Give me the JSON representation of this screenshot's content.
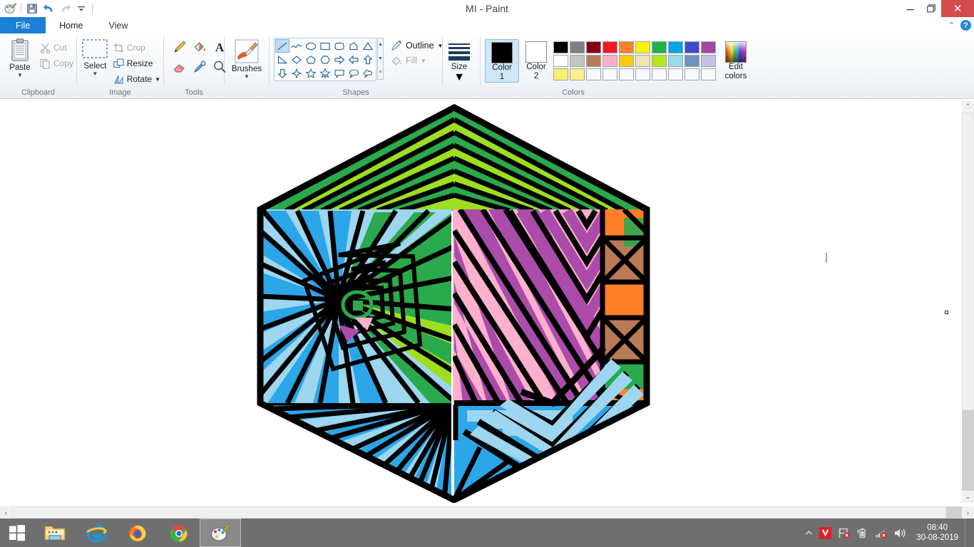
{
  "window": {
    "title": "MI - Paint",
    "minimize_label": "–",
    "maximize_label": "❐",
    "close_label": "✕"
  },
  "quick_access": {
    "items": [
      {
        "name": "paint-app-icon",
        "label": "Paint"
      },
      {
        "name": "save-icon",
        "label": "Save"
      },
      {
        "name": "undo-icon",
        "label": "Undo"
      },
      {
        "name": "redo-icon",
        "label": "Redo"
      },
      {
        "name": "customize-qat-icon",
        "label": "Customize Quick Access Toolbar"
      }
    ]
  },
  "tabs": [
    {
      "id": "file",
      "label": "File",
      "active": false
    },
    {
      "id": "home",
      "label": "Home",
      "active": true
    },
    {
      "id": "view",
      "label": "View",
      "active": false
    }
  ],
  "ribbon_helpers": {
    "collapse_label": "⌃",
    "help_label": "?"
  },
  "ribbon": {
    "groups": [
      {
        "id": "clipboard",
        "label": "Clipboard",
        "big_button": {
          "label": "Paste",
          "caret": "▼"
        },
        "small_buttons": [
          {
            "label": "Cut",
            "icon": "scissors-icon",
            "disabled": true
          },
          {
            "label": "Copy",
            "icon": "copy-icon",
            "disabled": true
          }
        ]
      },
      {
        "id": "image",
        "label": "Image",
        "big_button": {
          "label": "Select",
          "caret": "▼"
        },
        "small_buttons": [
          {
            "label": "Crop",
            "icon": "crop-icon",
            "disabled": true
          },
          {
            "label": "Resize",
            "icon": "resize-icon",
            "disabled": false
          },
          {
            "label": "Rotate",
            "icon": "rotate-icon",
            "disabled": false,
            "caret": "▼"
          }
        ]
      },
      {
        "id": "tools",
        "label": "Tools",
        "tools": [
          {
            "name": "pencil-tool-icon",
            "label": "Pencil"
          },
          {
            "name": "fill-with-color-tool-icon",
            "label": "Fill with color"
          },
          {
            "name": "text-tool-icon",
            "label": "Text"
          },
          {
            "name": "eraser-tool-icon",
            "label": "Eraser"
          },
          {
            "name": "color-picker-tool-icon",
            "label": "Color picker"
          },
          {
            "name": "magnifier-tool-icon",
            "label": "Magnifier"
          }
        ]
      },
      {
        "id": "brushes",
        "label": "",
        "big_button": {
          "label": "Brushes",
          "caret": "▼"
        }
      },
      {
        "id": "shapes",
        "label": "Shapes",
        "shape_items": [
          "line-shape",
          "curve-shape",
          "oval-shape",
          "rectangle-shape",
          "rounded-rectangle-shape",
          "polygon-shape",
          "triangle-shape",
          "right-triangle-shape",
          "diamond-shape",
          "pentagon-shape",
          "hexagon-shape",
          "right-arrow-shape",
          "left-arrow-shape",
          "up-arrow-shape",
          "down-arrow-shape",
          "four-point-star-shape",
          "five-point-star-shape",
          "six-point-star-shape",
          "rounded-callout-shape",
          "oval-callout-shape",
          "cloud-callout-shape"
        ],
        "selected_shape": "line-shape",
        "outline": {
          "label": "Outline",
          "caret": "▼"
        },
        "fill": {
          "label": "Fill",
          "caret": "▼",
          "disabled": true
        },
        "scroll": {
          "up": "▲",
          "down": "▼",
          "more": "≡"
        }
      },
      {
        "id": "size",
        "label": "",
        "big_button": {
          "label": "Size",
          "caret": "▼"
        }
      },
      {
        "id": "colors",
        "label": "Colors",
        "color1": {
          "label_line1": "Color",
          "label_line2": "1",
          "value": "#000000",
          "active": true
        },
        "color2": {
          "label_line1": "Color",
          "label_line2": "2",
          "value": "#ffffff",
          "active": false
        },
        "palette_rows": [
          [
            "#000000",
            "#7f7f7f",
            "#880015",
            "#ed1c24",
            "#ff7f27",
            "#fff200",
            "#22b14c",
            "#00a2e8",
            "#3f48cc",
            "#a349a4"
          ],
          [
            "#ffffff",
            "#c3c3c3",
            "#b97a57",
            "#ffaec9",
            "#ffc90e",
            "#efe4b0",
            "#b5e61d",
            "#99d9ea",
            "#7092be",
            "#c8bfe7"
          ],
          [
            "#fbef6e",
            "#fbf08e",
            "#f8f9fb",
            "#f8f9fb",
            "#f8f9fb",
            "#f8f9fb",
            "#f8f9fb",
            "#f8f9fb",
            "#f8f9fb",
            "#f8f9fb"
          ]
        ],
        "edit_colors": {
          "label_line1": "Edit",
          "label_line2": "colors"
        }
      }
    ]
  },
  "canvas": {
    "background": "#ffffff",
    "artwork_name": "geometric-hexagon-stripe-drawing",
    "artwork_colors": {
      "outline": "#000000",
      "green_dark": "#2aaa4c",
      "green_light": "#9ede1f",
      "blue_mid": "#2ba6e8",
      "blue_light": "#9dd6ee",
      "pink": "#ffb0cd",
      "purple": "#ab4cab",
      "orange": "#ff7f27",
      "brown": "#b97a57"
    },
    "vscroll": {
      "up": "⌃",
      "down": "⌄"
    },
    "hscroll": {
      "left": "‹",
      "right": "›"
    }
  },
  "taskbar": {
    "start_label": "Start",
    "apps": [
      {
        "name": "file-explorer-taskbar-icon",
        "label": "File Explorer",
        "active": false
      },
      {
        "name": "internet-explorer-taskbar-icon",
        "label": "Internet Explorer",
        "active": false
      },
      {
        "name": "firefox-taskbar-icon",
        "label": "Mozilla Firefox",
        "active": false
      },
      {
        "name": "chrome-taskbar-icon",
        "label": "Google Chrome",
        "active": false
      },
      {
        "name": "paint-taskbar-icon",
        "label": "Paint",
        "active": true
      }
    ],
    "tray": [
      {
        "name": "show-hidden-icons-icon",
        "label": "Show hidden icons"
      },
      {
        "name": "avira-antivirus-icon",
        "label": "Avira"
      },
      {
        "name": "action-center-icon",
        "label": "Action Center"
      },
      {
        "name": "battery-icon",
        "label": "Battery"
      },
      {
        "name": "network-icon",
        "label": "Network"
      },
      {
        "name": "volume-icon",
        "label": "Volume"
      }
    ],
    "clock": {
      "time": "08:40",
      "date": "30-08-2019"
    }
  }
}
